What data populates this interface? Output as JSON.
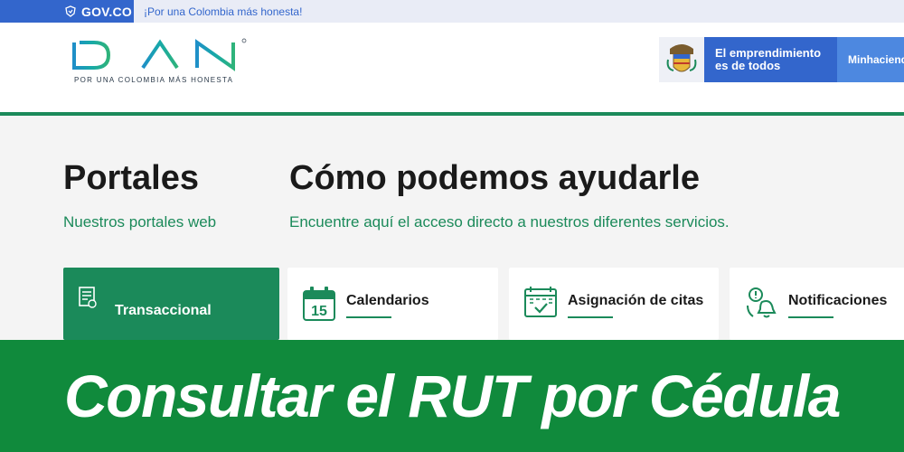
{
  "govbar": {
    "logo_text": "GOV.CO",
    "slogan": "¡Por una Colombia más honesta!"
  },
  "header": {
    "logo_text": "DIAN",
    "logo_tagline": "POR UNA COLOMBIA MÁS HONESTA",
    "brand_line1": "El emprendimiento",
    "brand_line2": "es de todos",
    "ministry_partial": "Minhacienda"
  },
  "main": {
    "portales_title": "Portales",
    "portales_subtitle": "Nuestros portales web",
    "ayuda_title": "Cómo podemos ayudarle",
    "ayuda_subtitle": "Encuentre aquí el acceso directo a nuestros diferentes servicios.",
    "cards": [
      {
        "label": "Transaccional",
        "icon": "transactional-icon"
      },
      {
        "label": "Calendarios",
        "icon": "calendar-icon",
        "icon_number": "15"
      },
      {
        "label": "Asignación de citas",
        "icon": "appointment-icon"
      },
      {
        "label": "Notificaciones",
        "icon": "notification-icon"
      }
    ]
  },
  "banner": {
    "text": "Consultar el RUT por Cédula"
  },
  "colors": {
    "gov_blue": "#3366cc",
    "dian_green": "#1b8a5a",
    "banner_green": "#108a3c"
  }
}
